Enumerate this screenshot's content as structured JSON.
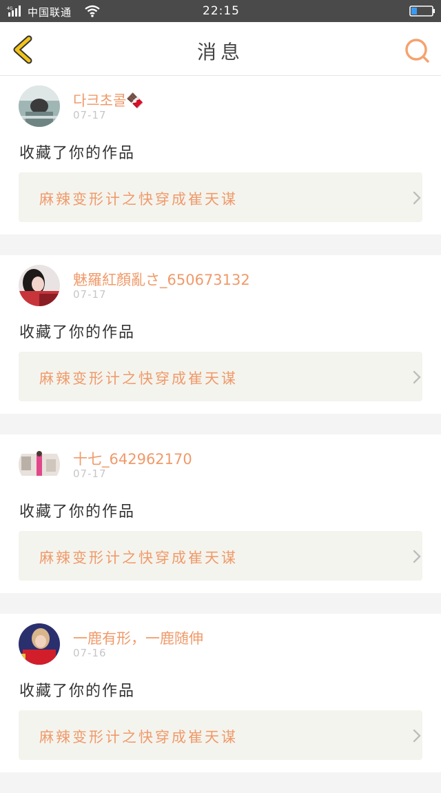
{
  "status_bar": {
    "network": "4G",
    "carrier": "中国联通",
    "time": "22:15"
  },
  "header": {
    "title": "消息"
  },
  "colors": {
    "accent": "#f09a6a",
    "back_icon": "#f3c31a",
    "search_icon": "#f5a26e",
    "card_link_bg": "#f4f4ee"
  },
  "notifications": [
    {
      "username": "다크초콜🍫",
      "date": "07-17",
      "action": "收藏了你的作品",
      "work_title": "麻辣变形计之快穿成崔天谋"
    },
    {
      "username": "魅羅紅顏亂さ_650673132",
      "date": "07-17",
      "action": "收藏了你的作品",
      "work_title": "麻辣变形计之快穿成崔天谋"
    },
    {
      "username": "十七_642962170",
      "date": "07-17",
      "action": "收藏了你的作品",
      "work_title": "麻辣变形计之快穿成崔天谋"
    },
    {
      "username": "一鹿有形，一鹿随伸",
      "date": "07-16",
      "action": "收藏了你的作品",
      "work_title": "麻辣变形计之快穿成崔天谋"
    }
  ]
}
